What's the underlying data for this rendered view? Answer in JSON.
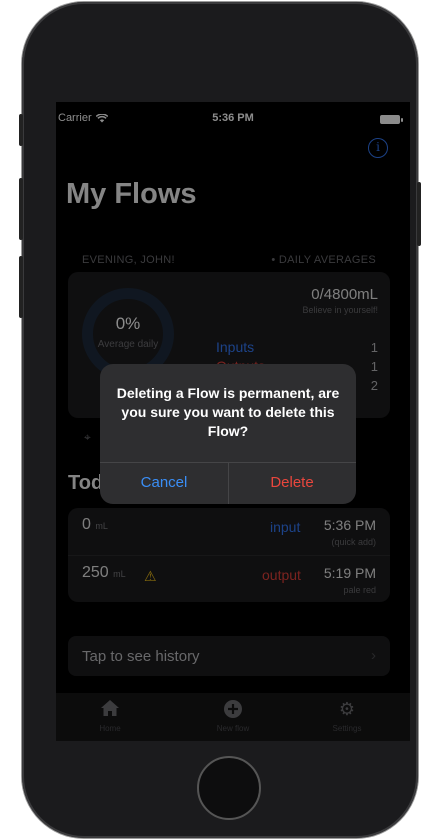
{
  "status_bar": {
    "carrier": "Carrier",
    "time": "5:36 PM"
  },
  "header": {
    "title": "My Flows",
    "info_icon": "info-circle-icon"
  },
  "summary": {
    "greeting": "EVENING, JOHN!",
    "averages_label": "• DAILY AVERAGES",
    "percent": "0%",
    "percent_label": "Average daily",
    "goal": "0/4800mL",
    "motivation": "Believe in yourself!",
    "inputs_label": "Inputs",
    "inputs_value": "1",
    "outputs_label": "Outputs",
    "outputs_value": "1",
    "total_value": "2"
  },
  "today": {
    "title": "Today",
    "entries": [
      {
        "amount": "0",
        "unit": "mL",
        "type": "input",
        "time": "5:36 PM",
        "note": "(quick add)",
        "warning": false
      },
      {
        "amount": "250",
        "unit": "mL",
        "type": "output",
        "time": "5:19 PM",
        "note": "pale red",
        "warning": true
      }
    ]
  },
  "history": {
    "label": "Tap to see history"
  },
  "tabbar": [
    {
      "label": "Home",
      "icon": "home-icon"
    },
    {
      "label": "New flow",
      "icon": "plus-circle-icon"
    },
    {
      "label": "Settings",
      "icon": "gear-icon"
    }
  ],
  "alert": {
    "message": "Deleting a Flow is permanent, are you sure you want to delete this Flow?",
    "cancel_label": "Cancel",
    "delete_label": "Delete"
  },
  "colors": {
    "accent_blue": "#3478f6",
    "destructive_red": "#e9463d",
    "warning_yellow": "#f3c119"
  }
}
